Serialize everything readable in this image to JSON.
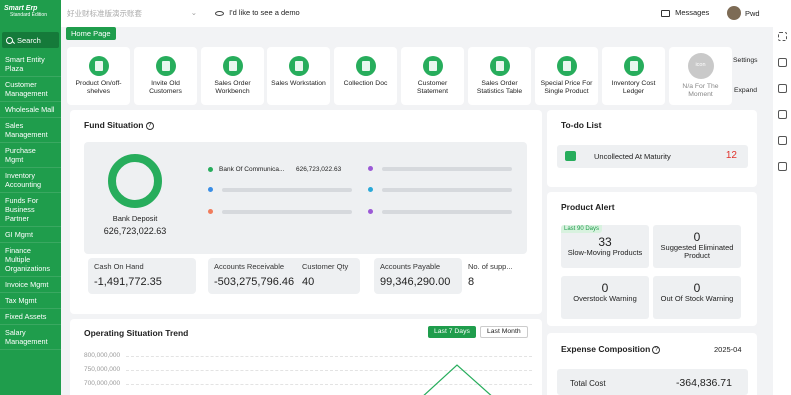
{
  "colors": {
    "accent": "#1f9d4c",
    "alert_red": "#e0322b"
  },
  "sidebar": {
    "logo_line1": "Smart Erp",
    "logo_line2": "Standard Edition",
    "search_label": "Search",
    "items": [
      {
        "label": "Smart Entity Plaza"
      },
      {
        "label": "Customer Management"
      },
      {
        "label": "Wholesale Mall"
      },
      {
        "label": "Sales Management"
      },
      {
        "label": "Purchase Mgmt"
      },
      {
        "label": "Inventory Accounting"
      },
      {
        "label": "Funds For Business Partner"
      },
      {
        "label": "GI Mgmt"
      },
      {
        "label": "Finance Multiple Organizations"
      },
      {
        "label": "Invoice Mgmt"
      },
      {
        "label": "Tax Mgmt"
      },
      {
        "label": "Fixed Assets"
      },
      {
        "label": "Salary Management"
      }
    ]
  },
  "topbar": {
    "org_placeholder": "好业财标准版演示账套",
    "demo_label": "I'd like to see a demo",
    "messages_label": "Messages",
    "username": "Pwd"
  },
  "tabs": {
    "home": "Home Page"
  },
  "quick": {
    "items": [
      {
        "label": "Product On/off-shelves",
        "icon": "shelf-icon"
      },
      {
        "label": "Invite Old Customers",
        "icon": "chart-icon"
      },
      {
        "label": "Sales Order Workbench",
        "icon": "store-icon"
      },
      {
        "label": "Sales Workstation",
        "icon": "doc-icon"
      },
      {
        "label": "Collection Doc",
        "icon": "edit-doc-icon"
      },
      {
        "label": "Customer Statement",
        "icon": "cart-icon"
      },
      {
        "label": "Sales Order Statistics Table",
        "icon": "table-icon"
      },
      {
        "label": "Special Price For Single Product",
        "icon": "price-tag-icon"
      },
      {
        "label": "Inventory Cost Ledger",
        "icon": "ledger-icon"
      },
      {
        "label": "N/a For The Moment",
        "icon_text": "icon"
      }
    ],
    "settings_label": "Settings",
    "expand_label": "Expand"
  },
  "fund": {
    "title": "Fund Situation",
    "bank_label": "Bank Deposit",
    "bank_value": "626,723,022.63",
    "legend_name": "Bank Of Communica...",
    "legend_value": "626,723,022.63",
    "stats": [
      {
        "label": "Cash On Hand",
        "value": "-1,491,772.35"
      },
      {
        "label": "Accounts Receivable",
        "value": "-503,275,796.46"
      },
      {
        "label": "Customer Qty",
        "value": "40"
      },
      {
        "label": "Accounts Payable",
        "value": "99,346,290.00"
      },
      {
        "label": "No. of supp...",
        "value": "8"
      }
    ]
  },
  "trend": {
    "title": "Operating Situation Trend",
    "btn_7days": "Last 7 Days",
    "btn_month": "Last Month",
    "yticks": [
      "800,000,000",
      "750,000,000",
      "700,000,000"
    ]
  },
  "todo": {
    "title": "To-do List",
    "item_label": "Uncollected At Maturity",
    "item_count": "12"
  },
  "alert": {
    "title": "Product Alert",
    "badge": "Last 90 Days",
    "cards": [
      {
        "value": "33",
        "label": "Slow-Moving Products"
      },
      {
        "value": "0",
        "label": "Suggested Eliminated Product"
      },
      {
        "value": "0",
        "label": "Overstock Warning"
      },
      {
        "value": "0",
        "label": "Out Of Stock Warning"
      }
    ]
  },
  "expense": {
    "title": "Expense Composition",
    "date": "2025-04",
    "label": "Total Cost",
    "value": "-364,836.71"
  }
}
